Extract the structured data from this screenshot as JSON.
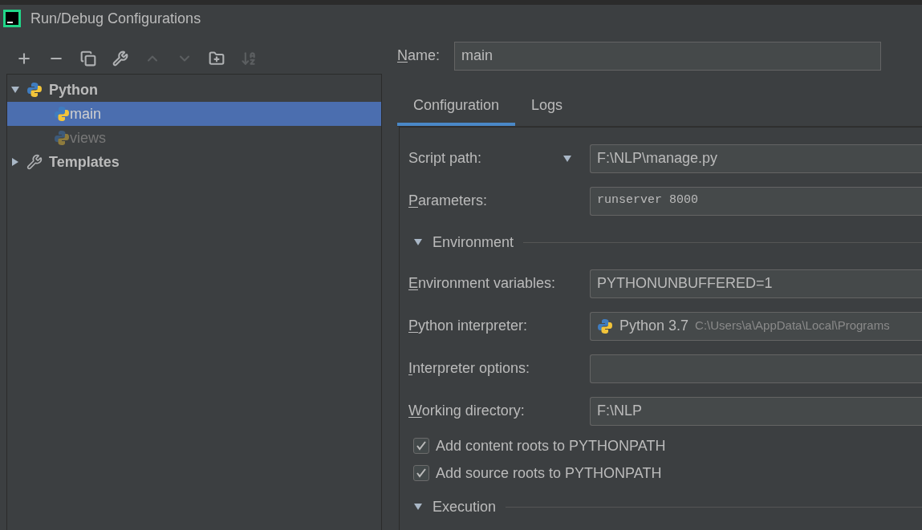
{
  "window": {
    "title": "Run/Debug Configurations"
  },
  "tree": [
    {
      "label": "Python",
      "expanded": true,
      "kind": "python",
      "children": [
        {
          "label": "main",
          "selected": true,
          "disabled": false
        },
        {
          "label": "views",
          "selected": false,
          "disabled": true
        }
      ]
    },
    {
      "label": "Templates",
      "expanded": false,
      "kind": "templates"
    }
  ],
  "name_field": {
    "label": "Name:",
    "underline_first": true,
    "value": "main"
  },
  "tabs": [
    {
      "label": "Configuration",
      "selected": true
    },
    {
      "label": "Logs",
      "selected": false
    }
  ],
  "rows": [
    {
      "kind": "script",
      "label": "Script path:",
      "underline_first": false,
      "value": "F:\\NLP\\manage.py"
    },
    {
      "kind": "code_field",
      "label": "Parameters:",
      "underline_first": true,
      "value": "runserver 8000"
    },
    {
      "kind": "section",
      "label": "Environment",
      "expanded": true
    },
    {
      "kind": "field",
      "label": "Environment variables:",
      "underline_first": true,
      "value": "PYTHONUNBUFFERED=1"
    },
    {
      "kind": "interpreter",
      "label": "Python interpreter:",
      "underline_first": true,
      "value": "Python 3.7",
      "path": "C:\\Users\\a\\AppData\\Local\\Programs"
    },
    {
      "kind": "field",
      "label": "Interpreter options:",
      "underline_first": true
    },
    {
      "kind": "field",
      "label": "Working directory:",
      "underline_first": true,
      "value": "F:\\NLP"
    },
    {
      "kind": "checkbox",
      "label": "Add content roots to PYTHONPATH",
      "checked": true
    },
    {
      "kind": "checkbox",
      "label": "Add source roots to PYTHONPATH",
      "checked": true
    },
    {
      "kind": "section",
      "label": "Execution",
      "expanded": true
    }
  ]
}
